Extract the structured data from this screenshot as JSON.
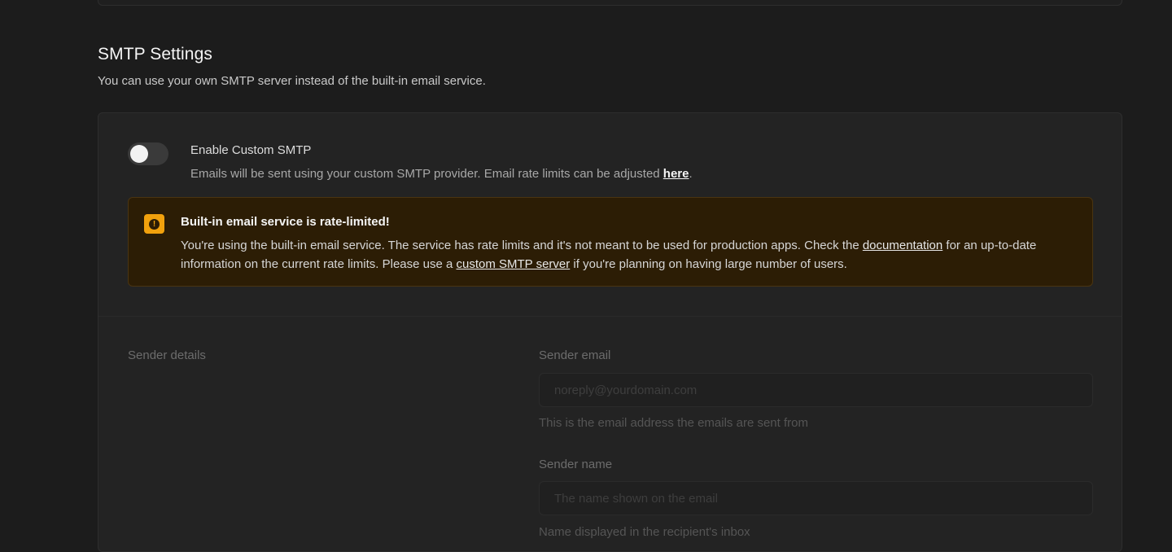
{
  "section": {
    "title": "SMTP Settings",
    "description": "You can use your own SMTP server instead of the built-in email service."
  },
  "toggle": {
    "label": "Enable Custom SMTP",
    "enabled": false,
    "description_prefix": "Emails will be sent using your custom SMTP provider. Email rate limits can be adjusted ",
    "description_link": "here",
    "description_suffix": "."
  },
  "alert": {
    "icon": "alert-circle-icon",
    "title": "Built-in email service is rate-limited!",
    "body_part1": "You're using the built-in email service. The service has rate limits and it's not meant to be used for production apps. Check the ",
    "doc_link": "documentation",
    "body_part2": " for an up-to-date information on the current rate limits. Please use a ",
    "smtp_link": "custom SMTP server",
    "body_part3": " if you're planning on having large number of users."
  },
  "sender": {
    "heading": "Sender details",
    "email": {
      "label": "Sender email",
      "placeholder": "noreply@yourdomain.com",
      "help": "This is the email address the emails are sent from"
    },
    "name": {
      "label": "Sender name",
      "placeholder": "The name shown on the email",
      "help": "Name displayed in the recipient's inbox"
    }
  },
  "colors": {
    "background": "#1c1c1c",
    "panel": "#232323",
    "warning_bg": "#2c1d05",
    "warning_accent": "#f1a10d"
  }
}
